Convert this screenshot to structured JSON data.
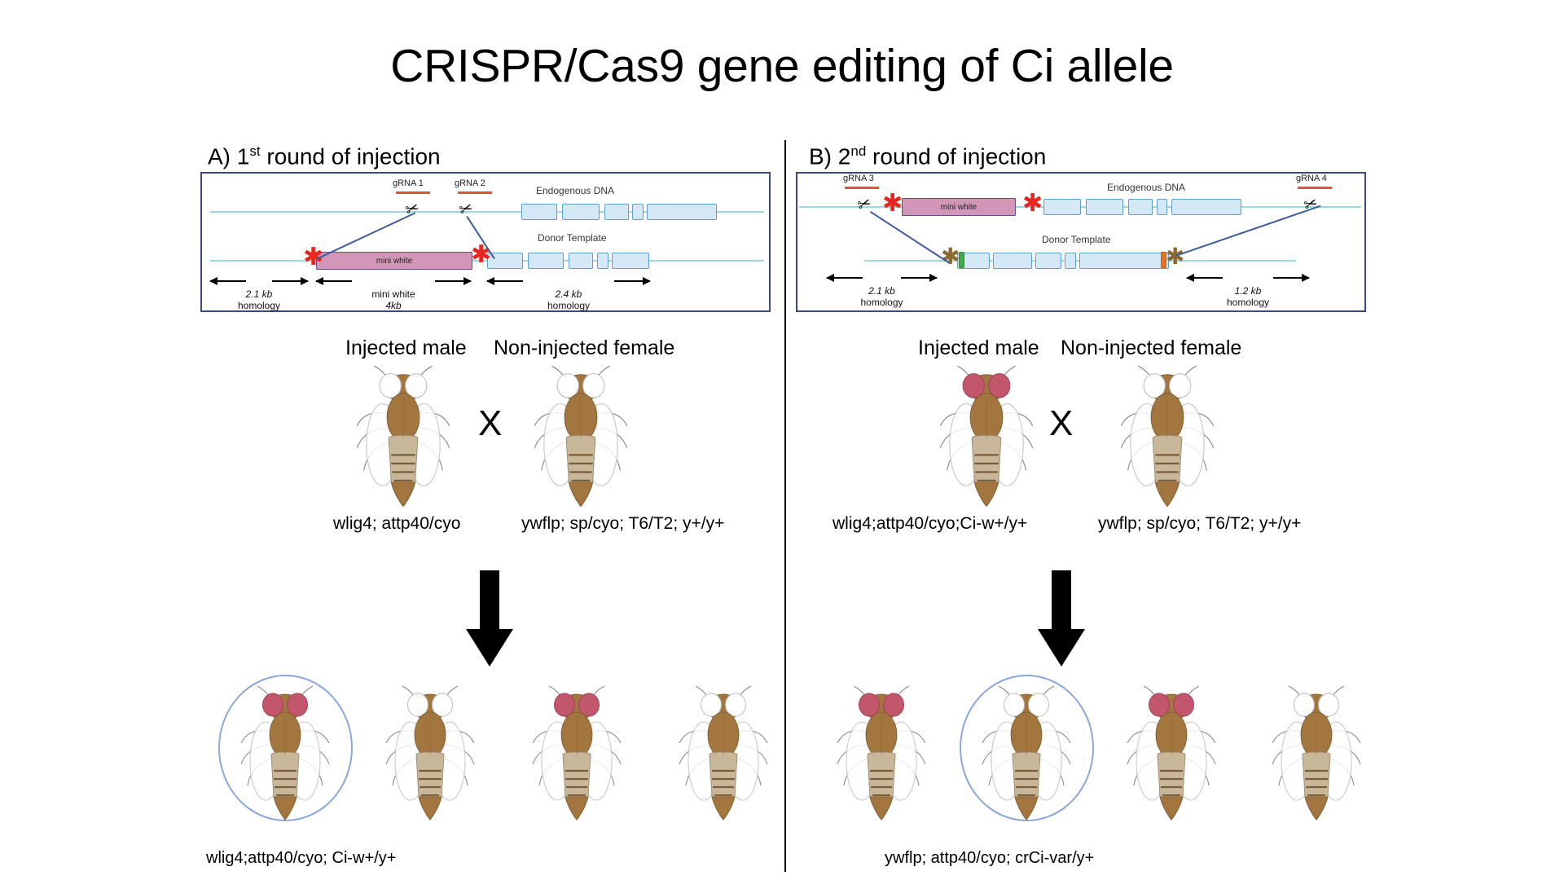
{
  "title": "CRISPR/Cas9 gene editing of Ci allele",
  "panels": [
    {
      "id": "A",
      "heading_prefix": "A) 1",
      "heading_sup": "st",
      "heading_suffix": " round of injection",
      "diagram": {
        "endogenous_label": "Endogenous DNA",
        "donor_label": "Donor Template",
        "grnas": [
          "gRNA 1",
          "gRNA 2"
        ],
        "cassette_label": "mini white",
        "homology_left": {
          "line1": "2.1 kb",
          "line2": "homology"
        },
        "homology_mid": {
          "line1": "mini white",
          "line2": "4kb"
        },
        "homology_right": {
          "line1": "2.4 kb",
          "line2": "homology"
        }
      },
      "cross": {
        "male_label": "Injected male",
        "female_label": "Non-injected female",
        "x_symbol": "X",
        "male_genotype": "wlig4; attp40/cyo",
        "female_genotype": "ywflp; sp/cyo; T6/T2; y+/y+"
      },
      "offspring_genotype": "wlig4;attp40/cyo; Ci-w+/y+",
      "offspring": [
        {
          "eyes": "red",
          "highlighted": true
        },
        {
          "eyes": "white",
          "highlighted": false
        },
        {
          "eyes": "red",
          "highlighted": false
        },
        {
          "eyes": "white",
          "highlighted": false
        }
      ]
    },
    {
      "id": "B",
      "heading_prefix": "B) 2",
      "heading_sup": "nd",
      "heading_suffix": " round of injection",
      "diagram": {
        "endogenous_label": "Endogenous DNA",
        "donor_label": "Donor Template",
        "grnas": [
          "gRNA 3",
          "gRNA 4"
        ],
        "cassette_label": "mini white",
        "homology_left": {
          "line1": "2.1 kb",
          "line2": "homology"
        },
        "homology_right": {
          "line1": "1.2 kb",
          "line2": "homology"
        }
      },
      "cross": {
        "male_label": "Injected male",
        "female_label": "Non-injected female",
        "x_symbol": "X",
        "male_genotype": "wlig4;attp40/cyo;Ci-w+/y+",
        "female_genotype": "ywflp; sp/cyo; T6/T2; y+/y+"
      },
      "offspring_genotype": "ywflp; attp40/cyo; crCi-var/y+",
      "offspring": [
        {
          "eyes": "red",
          "highlighted": false
        },
        {
          "eyes": "white",
          "highlighted": true
        },
        {
          "eyes": "red",
          "highlighted": false
        },
        {
          "eyes": "white",
          "highlighted": false
        }
      ]
    }
  ],
  "colors": {
    "box_border": "#3b4a7a",
    "dna_line": "#9ed7df",
    "exon_fill": "#d4e8f5",
    "exon_border": "#5e9fc9",
    "mini_white_fill": "#d196b8",
    "mini_white_border": "#6b4a8a",
    "grna_underline": "#e0562a",
    "red_star": "#e8251f",
    "brown_star": "#8a6a31",
    "recomb_line": "#3f5c9a",
    "highlight_ellipse": "#8aa8d8",
    "fly_body": "#a3763f",
    "fly_red_eye": "#c2576b",
    "marker_green": "#3fae49",
    "marker_orange": "#e8751f"
  }
}
